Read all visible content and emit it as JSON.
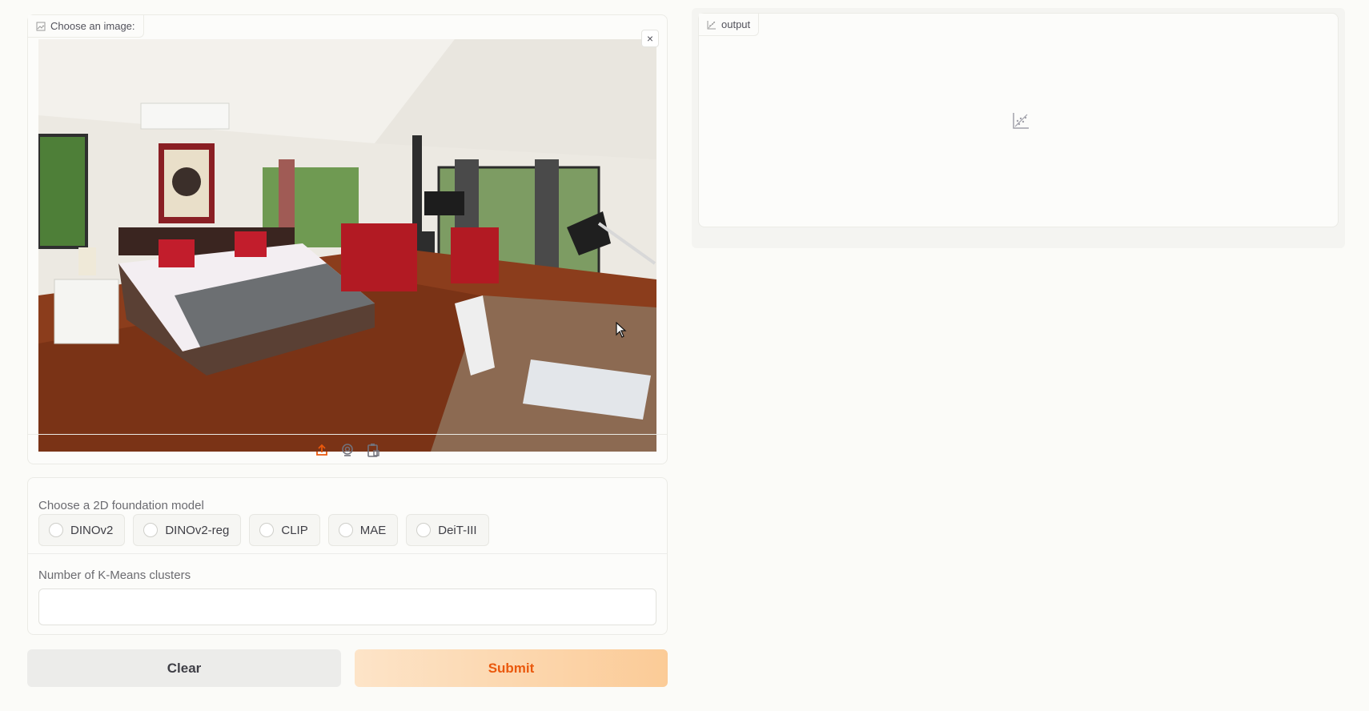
{
  "image_input": {
    "label": "Choose an image:",
    "label_icon": "image-icon",
    "close_symbol": "×",
    "tools": [
      "upload-icon",
      "webcam-icon",
      "clipboard-icon"
    ]
  },
  "model_choice": {
    "label": "Choose a 2D foundation model",
    "options": [
      "DINOv2",
      "DINOv2-reg",
      "CLIP",
      "MAE",
      "DeiT-III"
    ],
    "selected": null
  },
  "clusters": {
    "label": "Number of K-Means clusters",
    "value": ""
  },
  "buttons": {
    "clear": "Clear",
    "submit": "Submit"
  },
  "output": {
    "label": "output",
    "label_icon": "scatter-plot-icon",
    "placeholder_icon": "scatter-plot-icon"
  },
  "colors": {
    "accent": "#ea580c",
    "submit_gradient_start": "#fde4c8",
    "submit_gradient_end": "#fbcb97"
  }
}
